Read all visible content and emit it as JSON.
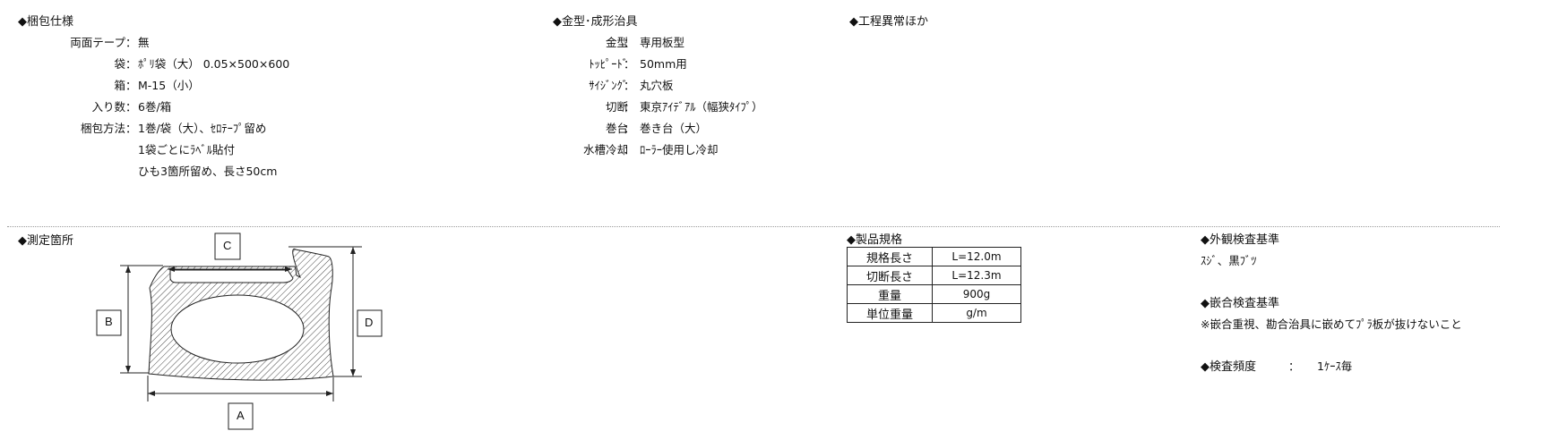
{
  "packaging": {
    "title": "◆梱包仕様",
    "rows": [
      {
        "key": "両面テープ",
        "value": "無"
      },
      {
        "key": "袋",
        "value": "ﾎﾟﾘ袋（大） 0.05×500×600"
      },
      {
        "key": "箱",
        "value": "M-15（小）"
      },
      {
        "key": "入り数",
        "value": "6巻/箱"
      },
      {
        "key": "梱包方法",
        "value": "1巻/袋（大）、ｾﾛﾃｰﾌﾟ留め"
      }
    ],
    "extra": [
      "1袋ごとにﾗﾍﾞﾙ貼付",
      "ひも3箇所留め、長さ50cm"
    ]
  },
  "tooling": {
    "title": "◆金型･成形治具",
    "rows": [
      {
        "key": "金型",
        "value": "専用板型"
      },
      {
        "key": "ﾄｯﾋﾟｰﾄﾞ",
        "value": "50mm用"
      },
      {
        "key": "ｻｲｼﾞﾝｸﾞ",
        "value": "丸穴板"
      },
      {
        "key": "切断",
        "value": "東京ｱｲﾃﾞｱﾙ（幅狭ﾀｲﾌﾟ）"
      },
      {
        "key": "巻台",
        "value": "巻き台（大）"
      },
      {
        "key": "水槽冷却",
        "value": "ﾛｰﾗｰ使用し冷却"
      }
    ]
  },
  "process": {
    "title": "◆工程異常ほか"
  },
  "measurement": {
    "title": "◆測定箇所",
    "labels": {
      "a": "A",
      "b": "B",
      "c": "C",
      "d": "D"
    }
  },
  "product_spec": {
    "title": "◆製品規格",
    "rows": [
      {
        "name": "規格長さ",
        "value": "L=12.0m"
      },
      {
        "name": "切断長さ",
        "value": "L=12.3m"
      },
      {
        "name": "重量",
        "value": "900g"
      },
      {
        "name": "単位重量",
        "value": "g/m"
      }
    ]
  },
  "inspection": {
    "appearance_title": "◆外観検査基準",
    "appearance_text": "ｽｼﾞ、黒ﾌﾞﾂ",
    "fit_title": "◆嵌合検査基準",
    "fit_text": "※嵌合重視、勘合治具に嵌めてﾌﾟﾗ板が抜けないこと",
    "frequency_label": "◆検査頻度",
    "frequency_sep": "：",
    "frequency_value": "1ｹｰｽ毎"
  }
}
